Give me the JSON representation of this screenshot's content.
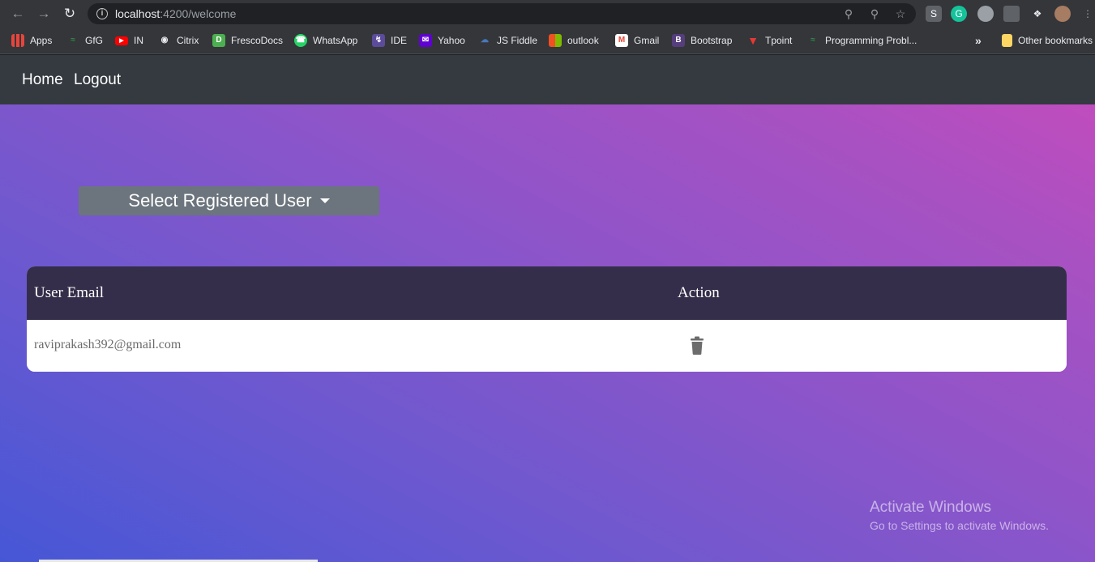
{
  "browser": {
    "url_host": "localhost",
    "url_path": ":4200/welcome"
  },
  "bookmarks": [
    {
      "label": "Apps",
      "icon": "apps-grid-icon"
    },
    {
      "label": "GfG",
      "icon": "gfg-icon"
    },
    {
      "label": "IN",
      "icon": "youtube-icon"
    },
    {
      "label": "Citrix",
      "icon": "citrix-icon"
    },
    {
      "label": "FrescoDocs",
      "icon": "frescodocs-icon"
    },
    {
      "label": "WhatsApp",
      "icon": "whatsapp-icon"
    },
    {
      "label": "IDE",
      "icon": "ide-icon"
    },
    {
      "label": "Yahoo",
      "icon": "yahoo-icon"
    },
    {
      "label": "JS Fiddle",
      "icon": "jsfiddle-icon"
    },
    {
      "label": "outlook",
      "icon": "microsoft-icon"
    },
    {
      "label": "Gmail",
      "icon": "gmail-icon"
    },
    {
      "label": "Bootstrap",
      "icon": "bootstrap-icon"
    },
    {
      "label": "Tpoint",
      "icon": "tpoint-icon"
    },
    {
      "label": "Programming Probl...",
      "icon": "gfg-icon"
    }
  ],
  "other_bookmarks": "Other bookmarks",
  "navbar": {
    "home": "Home",
    "logout": "Logout"
  },
  "dropdown": {
    "label": "Select Registered User"
  },
  "table": {
    "headers": [
      "User Email",
      "Action"
    ],
    "rows": [
      {
        "email": "raviprakash392@gmail.com",
        "action_icon": "trash-icon"
      }
    ]
  },
  "watermark": {
    "title": "Activate Windows",
    "subtitle": "Go to Settings to activate Windows."
  },
  "colors": {
    "navbar": "#343a40",
    "dropdown": "#6c757d",
    "table_header": "#352e4a",
    "gradient_start": "#4657d6",
    "gradient_end": "#c74bbd"
  }
}
